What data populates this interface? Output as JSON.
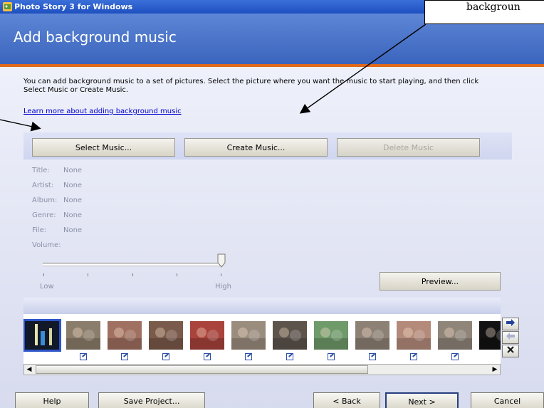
{
  "window": {
    "title": "Photo Story 3 for Windows"
  },
  "header": {
    "title": "Add background music"
  },
  "description": "You can add background music to a set of pictures.  Select the picture where you want the music to start playing, and then click Select Music or Create Music.",
  "learn_more_link": "Learn more about adding background music",
  "music_buttons": {
    "select": "Select Music...",
    "create": "Create Music...",
    "delete": "Delete Music"
  },
  "music_info": [
    {
      "label": "Title:",
      "value": "None"
    },
    {
      "label": "Artist:",
      "value": "None"
    },
    {
      "label": "Album:",
      "value": "None"
    },
    {
      "label": "Genre:",
      "value": "None"
    },
    {
      "label": "File:",
      "value": "None"
    }
  ],
  "volume": {
    "label": "Volume:",
    "low_label": "Low",
    "high_label": "High",
    "level": 1.0
  },
  "preview_button": "Preview...",
  "filmstrip": {
    "thumbnails": [
      {
        "name": "night-scene",
        "color": "#111827",
        "selected": true
      },
      {
        "name": "photo-2",
        "color": "#8b7d6b"
      },
      {
        "name": "photo-3",
        "color": "#a07060"
      },
      {
        "name": "photo-4",
        "color": "#7a5a4a"
      },
      {
        "name": "photo-5",
        "color": "#a9433b"
      },
      {
        "name": "photo-6",
        "color": "#9a8d7d"
      },
      {
        "name": "photo-7",
        "color": "#5d544c"
      },
      {
        "name": "photo-8",
        "color": "#6f9a6a"
      },
      {
        "name": "photo-9",
        "color": "#8d8074"
      },
      {
        "name": "photo-10",
        "color": "#b48a7a"
      },
      {
        "name": "photo-11",
        "color": "#8f8579"
      },
      {
        "name": "photo-12",
        "color": "#121212"
      }
    ],
    "nav_icons": [
      "arrow-right-icon",
      "arrow-left-icon",
      "delete-x-icon"
    ]
  },
  "footer": {
    "help": "Help",
    "save_project": "Save Project...",
    "back": "< Back",
    "next": "Next >",
    "cancel": "Cancel"
  },
  "callout_text": "backgroun",
  "colors": {
    "header_top": "#5d86d6",
    "header_bottom": "#3b65bd",
    "accent_orange": "#e06a1b",
    "selection": "#2d55c9"
  }
}
